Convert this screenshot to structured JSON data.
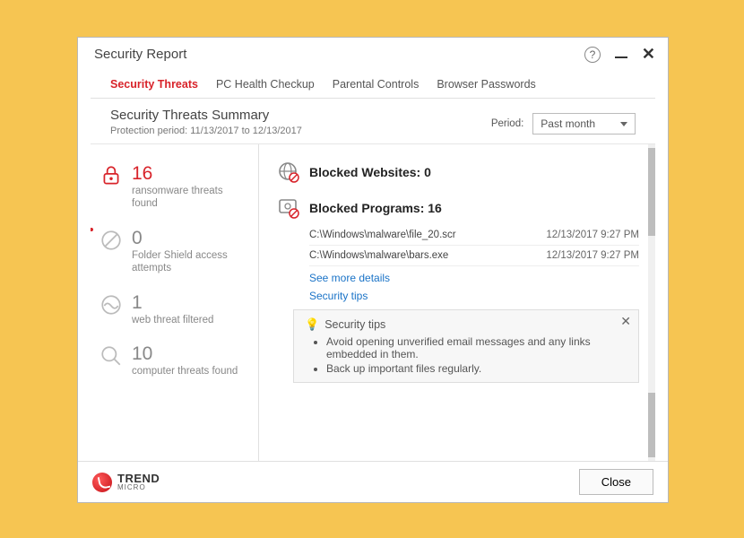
{
  "window": {
    "title": "Security Report"
  },
  "tabs": [
    {
      "label": "Security Threats",
      "active": true
    },
    {
      "label": "PC Health Checkup"
    },
    {
      "label": "Parental Controls"
    },
    {
      "label": "Browser Passwords"
    }
  ],
  "summary": {
    "title": "Security Threats Summary",
    "protection_period": "Protection period: 11/13/2017 to 12/13/2017",
    "period_label": "Period:",
    "period_value": "Past month"
  },
  "stats": {
    "ransomware": {
      "count": "16",
      "label": "ransomware threats found"
    },
    "folder_shield": {
      "count": "0",
      "label": "Folder Shield access attempts"
    },
    "web_threat": {
      "count": "1",
      "label": "web threat filtered"
    },
    "computer_threats": {
      "count": "10",
      "label": "computer threats found"
    }
  },
  "blocked_websites": {
    "heading": "Blocked Websites: 0"
  },
  "blocked_programs": {
    "heading": "Blocked Programs: 16",
    "entries": [
      {
        "path": "C:\\Windows\\malware\\file_20.scr",
        "time": "12/13/2017 9:27 PM"
      },
      {
        "path": "C:\\Windows\\malware\\bars.exe",
        "time": "12/13/2017 9:27 PM"
      }
    ]
  },
  "links": {
    "more": "See more details",
    "tips": "Security tips"
  },
  "tips_panel": {
    "title": "Security tips",
    "items": [
      "Avoid opening unverified email messages and any links embedded in them.",
      "Back up important files regularly."
    ]
  },
  "footer": {
    "brand_top": "TREND",
    "brand_bottom": "MICRO",
    "close": "Close"
  }
}
